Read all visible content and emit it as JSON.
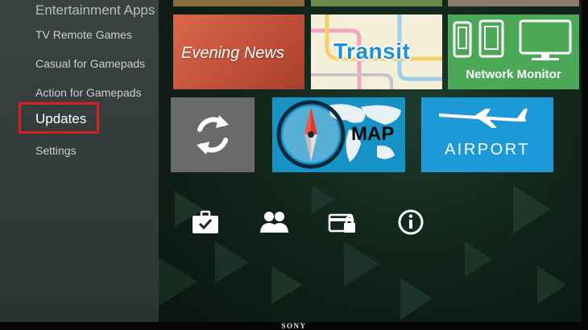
{
  "sidebar": {
    "header": "Entertainment Apps",
    "items": [
      {
        "label": "TV Remote Games"
      },
      {
        "label": "Casual for Gamepads"
      },
      {
        "label": "Action for Gamepads"
      },
      {
        "label": "Updates",
        "selected": true
      },
      {
        "label": "Settings"
      }
    ],
    "highlight_color": "#d81f26"
  },
  "tiles": {
    "evening_news": {
      "title": "Evening News",
      "color": "#c4513b"
    },
    "transit": {
      "title": "Transit",
      "color": "#1b8fd8"
    },
    "network_monitor": {
      "title": "Network Monitor",
      "color": "#4aa856"
    },
    "updates": {
      "icon": "refresh-icon",
      "color": "#6a6a6a"
    },
    "map": {
      "title": "MAP",
      "icon": "compass-icon",
      "color": "#1792c6"
    },
    "airport": {
      "title": "AIRPORT",
      "icon": "airplane-icon",
      "color": "#1c9ad8"
    }
  },
  "actions": [
    {
      "icon": "briefcase-check-icon"
    },
    {
      "icon": "people-icon"
    },
    {
      "icon": "card-lock-icon"
    },
    {
      "icon": "info-icon"
    }
  ],
  "bezel": {
    "brand": "SONY"
  }
}
